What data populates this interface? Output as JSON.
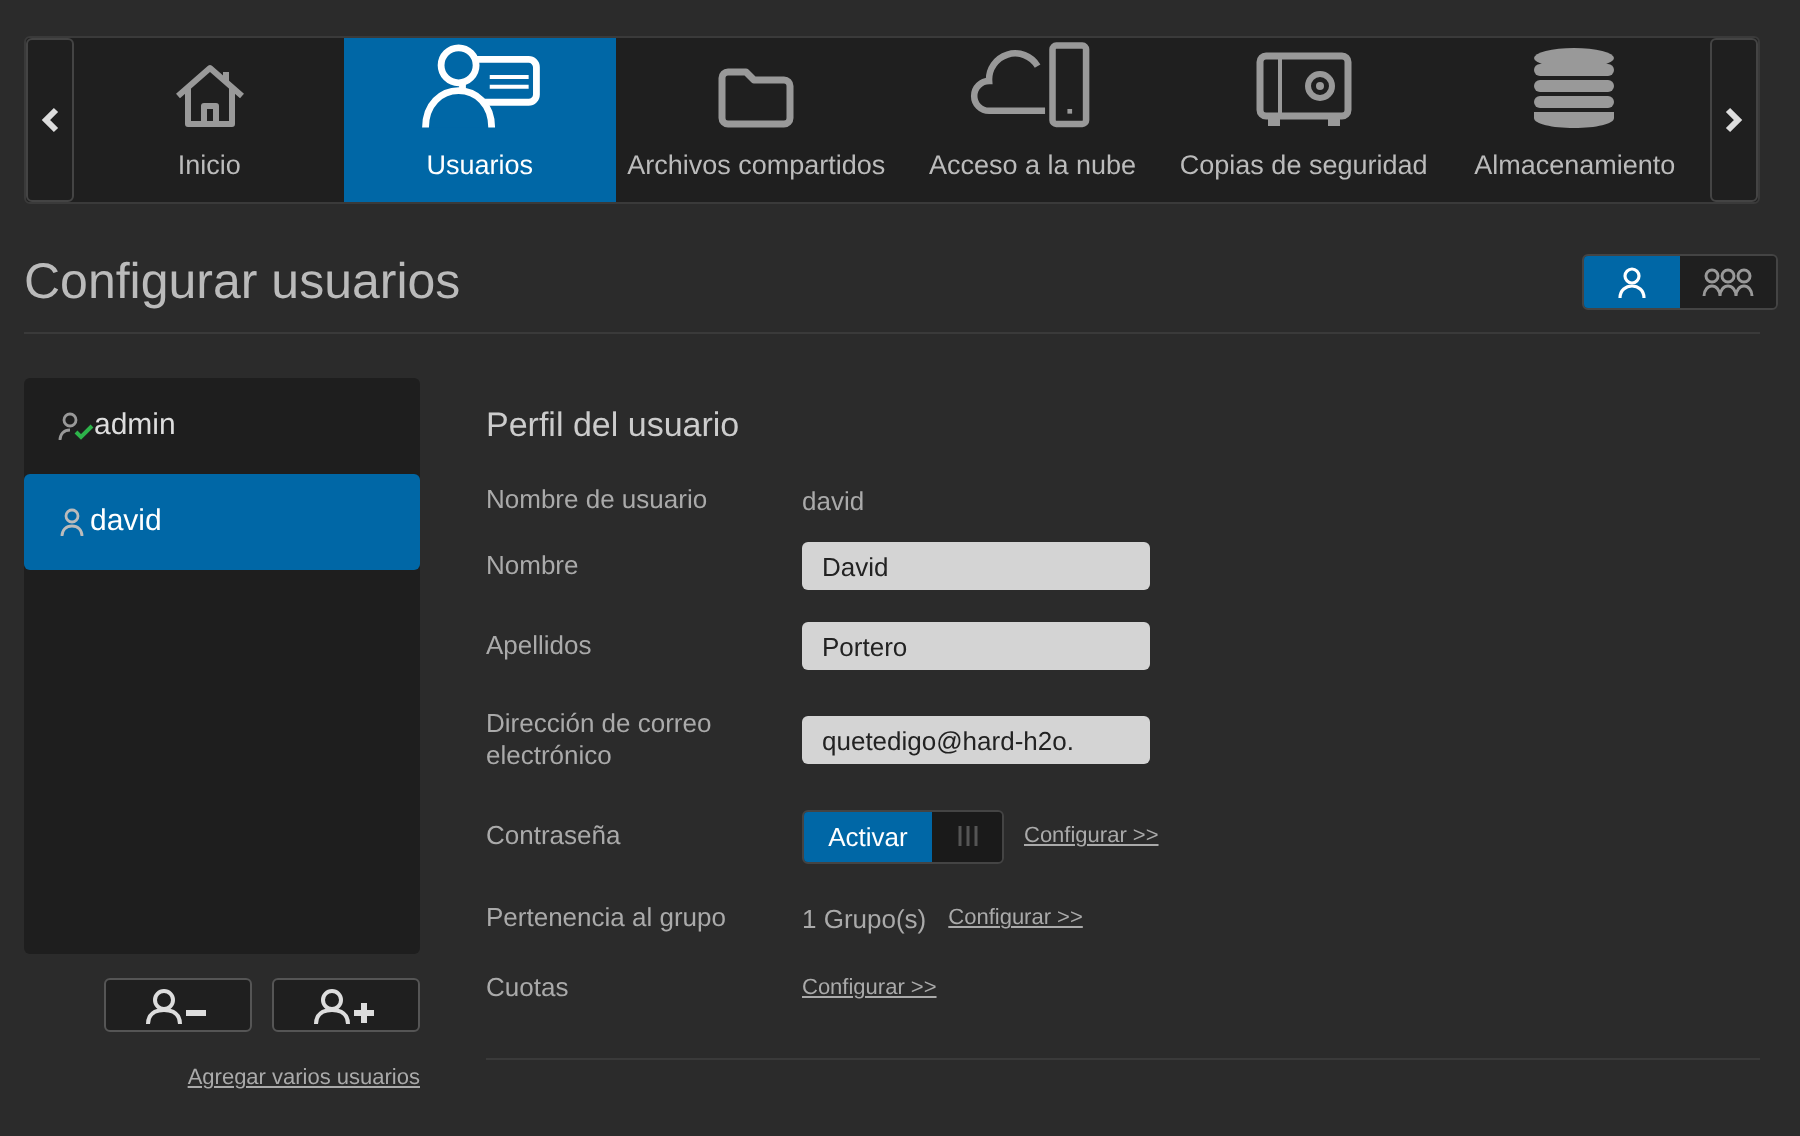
{
  "nav": {
    "tabs": [
      {
        "label": "Inicio",
        "selected": false
      },
      {
        "label": "Usuarios",
        "selected": true
      },
      {
        "label": "Archivos compartidos",
        "selected": false
      },
      {
        "label": "Acceso a la nube",
        "selected": false
      },
      {
        "label": "Copias de seguridad",
        "selected": false
      },
      {
        "label": "Almacenamiento",
        "selected": false
      }
    ]
  },
  "page_title": "Configurar usuarios",
  "view_toggle": [
    {
      "selected": true
    },
    {
      "selected": false
    }
  ],
  "users": [
    {
      "name": "admin",
      "selected": false,
      "admin": true
    },
    {
      "name": "david",
      "selected": true,
      "admin": false
    }
  ],
  "add_multiple_link": "Agregar varios usuarios",
  "profile": {
    "title": "Perfil del usuario",
    "rows": [
      {
        "kind": "text",
        "label": "Nombre de usuario",
        "value": "david"
      },
      {
        "kind": "input",
        "label": "Nombre",
        "value": "David"
      },
      {
        "kind": "input",
        "label": "Apellidos",
        "value": "Portero"
      },
      {
        "kind": "input",
        "label": "Dirección de correo electrónico",
        "value": "quetedigo@hard-h2o."
      },
      {
        "kind": "toggle",
        "label": "Contraseña",
        "toggle_label": "Activar",
        "on": true,
        "link": "Configurar >>"
      },
      {
        "kind": "text",
        "label": "Pertenencia al grupo",
        "value": "1 Grupo(s)",
        "link": "Configurar >>"
      },
      {
        "kind": "link",
        "label": "Cuotas",
        "link": "Configurar >>"
      }
    ]
  }
}
